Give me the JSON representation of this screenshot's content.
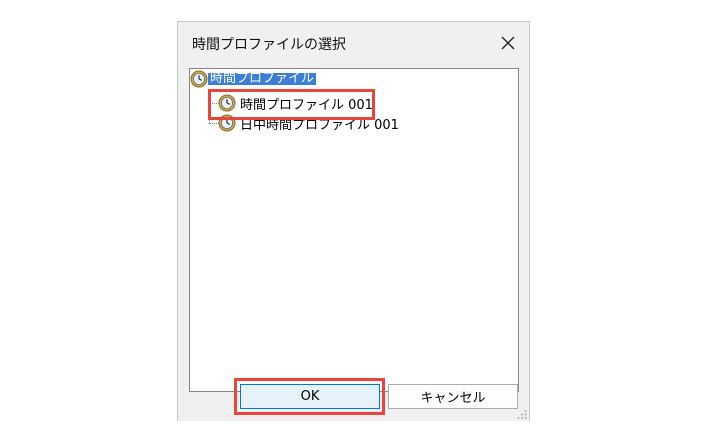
{
  "dialog": {
    "title": "時間プロファイルの選択",
    "close_label": "✕"
  },
  "tree": {
    "root_label": "時間プロファイル",
    "items": [
      {
        "label": "時間プロファイル 001"
      },
      {
        "label": "日中時間プロファイル 001"
      }
    ]
  },
  "buttons": {
    "ok_label": "OK",
    "cancel_label": "キャンセル"
  },
  "colors": {
    "highlight": "#e8453c",
    "selection": "#3b7fd9",
    "ok_button_border": "#0078d7"
  },
  "icons": [
    "clock-icon",
    "close-icon",
    "resize-grip-icon"
  ]
}
